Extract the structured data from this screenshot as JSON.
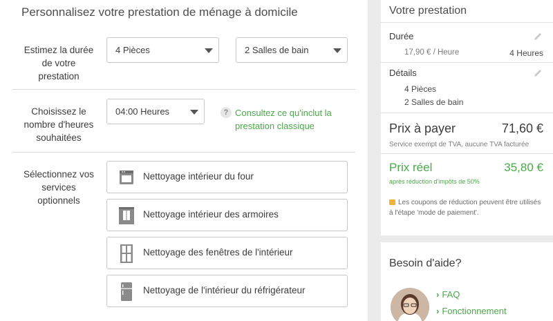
{
  "page_title": "Personnalisez votre prestation de ménage à domicile",
  "duration_section": {
    "label": "Estimez la durée de votre prestation",
    "rooms_select": "4 Pièces",
    "bathrooms_select": "2 Salles de bain"
  },
  "hours_section": {
    "label": "Choisissez le nombre d'heures souhaitées",
    "hours_select": "04:00 Heures",
    "help_icon": "?",
    "help_link": "Consultez ce qu'inclut la prestation classique"
  },
  "options_section": {
    "label": "Sélectionnez vos services optionnels",
    "options": [
      {
        "label": "Nettoyage intérieur du four",
        "icon": "oven-icon"
      },
      {
        "label": "Nettoyage intérieur des armoires",
        "icon": "wardrobe-icon"
      },
      {
        "label": "Nettoyage des fenêtres de l'intérieur",
        "icon": "window-icon"
      },
      {
        "label": "Nettoyage de l'intérieur du réfrigérateur",
        "icon": "fridge-icon"
      }
    ]
  },
  "summary": {
    "title": "Votre prestation",
    "duration_label": "Durée",
    "rate": "17,90 € / Heure",
    "hours": "4 Heures",
    "details_label": "Détails",
    "details": [
      "4 Pièces",
      "2 Salles de bain"
    ],
    "price_label": "Prix à payer",
    "price_value": "71,60 €",
    "price_note": "Service exempt de TVA, aucune TVA facturée",
    "real_label": "Prix réel",
    "real_value": "35,80 €",
    "real_note": "après réduction d'impôts de 50%",
    "coupon_note": "Les coupons de réduction peuvent être utilisés à l'étape 'mode de paiement'."
  },
  "help": {
    "title": "Besoin d'aide?",
    "links": [
      "FAQ",
      "Fonctionnement"
    ]
  },
  "colors": {
    "accent_green": "#4aa84a",
    "background": "#ebebeb"
  }
}
